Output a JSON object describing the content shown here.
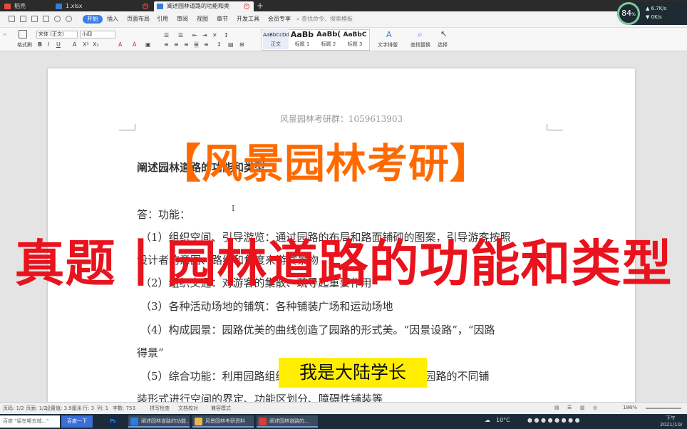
{
  "tabs": [
    {
      "label": "稻壳",
      "color": "#e34b3f"
    },
    {
      "label": "1.xlsx",
      "color": "#3a79d6"
    },
    {
      "label": "阐述园林道路的功能和类型.docx",
      "color": "#3a79d6"
    }
  ],
  "speed": {
    "value": "84",
    "unit": "%",
    "up": "6.7K/s",
    "down": "0K/s"
  },
  "menu": {
    "items": [
      "开始",
      "插入",
      "页面布局",
      "引用",
      "审阅",
      "视图",
      "章节",
      "开发工具",
      "会员专享"
    ],
    "search": "查找命令、搜索模板",
    "share": "分享",
    "collab": "协作"
  },
  "ribbon": {
    "paste": "粘贴",
    "format_painter": "格式刷",
    "font_name": "宋体 (正文)",
    "font_size": "小四",
    "styles": [
      {
        "sample": "AaBbCcDd",
        "name": "正文"
      },
      {
        "sample": "AaBb",
        "name": "标题 1"
      },
      {
        "sample": "AaBb(",
        "name": "标题 2"
      },
      {
        "sample": "AaBbC",
        "name": "标题 3"
      }
    ],
    "text_layout": "文字排版",
    "find_replace": "查找替换",
    "select": "选择"
  },
  "doc": {
    "header": "风景园林考研群：1059613903",
    "title": "阐述园林道路的功能和类型",
    "answer": "答：功能：",
    "lines": [
      "（1）组织空间、引导游览：通过园路的布局和路面铺砌的图案，引导游客按照",
      "设计者的意图、路线和角度来游赏景物",
      "（2）组织交通：对游客的集散、疏导起重要作用",
      "（3）各种活动场地的铺筑：各种铺装广场和运动场地",
      "（4）构成园景：园路优美的曲线创造了园路的形式美。“因景设路”，“因路",
      "得景”",
      "（5）综合功能：利用园路组织空间，使园景步移景异，利用园路的不同铺",
      "装形式进行空间的界定、功能区划分、障碍性铺装等"
    ]
  },
  "overlay": {
    "title": "【风景园林考研】",
    "banner": "真题丨园林道路的功能和类型",
    "badge": "我是大陆学长"
  },
  "status": {
    "page": "页码: 1/2",
    "pages": "页面: 1/2",
    "section": "设置值: 3.9厘米",
    "row": "行: 3",
    "col": "列: 1",
    "words": "字数: 753",
    "spell": "拼写检查",
    "docproof": "文档校对",
    "compat": "兼容模式",
    "zoom": "186%"
  },
  "taskbar": {
    "search_placeholder": "百度 \"留在哪去城...\"",
    "search_button": "百度一下",
    "apps": [
      "阐述园林道路的功能...",
      "风景园林考研资料",
      "阐述园林道路的..."
    ],
    "weather": "10°C",
    "time": "下午",
    "date": "2021/10/"
  }
}
